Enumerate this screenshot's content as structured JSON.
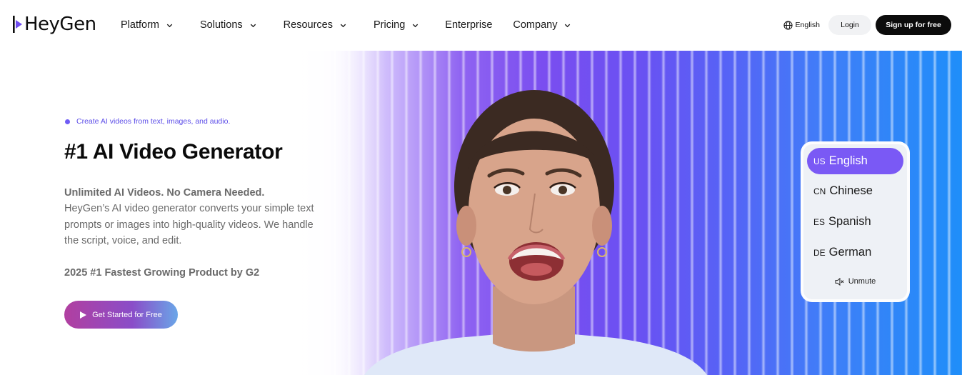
{
  "brand": {
    "name": "HeyGen"
  },
  "nav": {
    "items": [
      {
        "label": "Platform",
        "dropdown": true
      },
      {
        "label": "Solutions",
        "dropdown": true
      },
      {
        "label": "Resources",
        "dropdown": true
      },
      {
        "label": "Pricing",
        "dropdown": true
      },
      {
        "label": "Enterprise",
        "dropdown": false
      },
      {
        "label": "Company",
        "dropdown": true
      }
    ]
  },
  "header_right": {
    "language": "English",
    "login": "Login",
    "signup": "Sign up for free"
  },
  "hero": {
    "eyebrow": "Create AI videos from text, images, and audio.",
    "title": "#1 AI Video Generator",
    "subtitle": "Unlimited AI Videos. No Camera Needed.",
    "description": "HeyGen’s AI video generator converts your simple text prompts or images into high-quality videos. We handle the script, voice, and edit.",
    "badge": "2025 #1 Fastest Growing Product by G2",
    "cta": "Get Started for Free"
  },
  "language_picker": {
    "options": [
      {
        "code": "US",
        "label": "English",
        "active": true
      },
      {
        "code": "CN",
        "label": "Chinese",
        "active": false
      },
      {
        "code": "ES",
        "label": "Spanish",
        "active": false
      },
      {
        "code": "DE",
        "label": "German",
        "active": false
      }
    ],
    "unmute": "Unmute"
  },
  "colors": {
    "accent": "#7a59f5",
    "eyebrow": "#5b4ce8",
    "signup_bg": "#0c0c0c",
    "cta_gradient": [
      "#b13fa0",
      "#8a4dc8",
      "#6aa6e8"
    ]
  },
  "icons": {
    "globe": "globe-icon",
    "chevron": "chevron-down-icon",
    "play": "play-icon",
    "mute": "speaker-muted-icon"
  }
}
